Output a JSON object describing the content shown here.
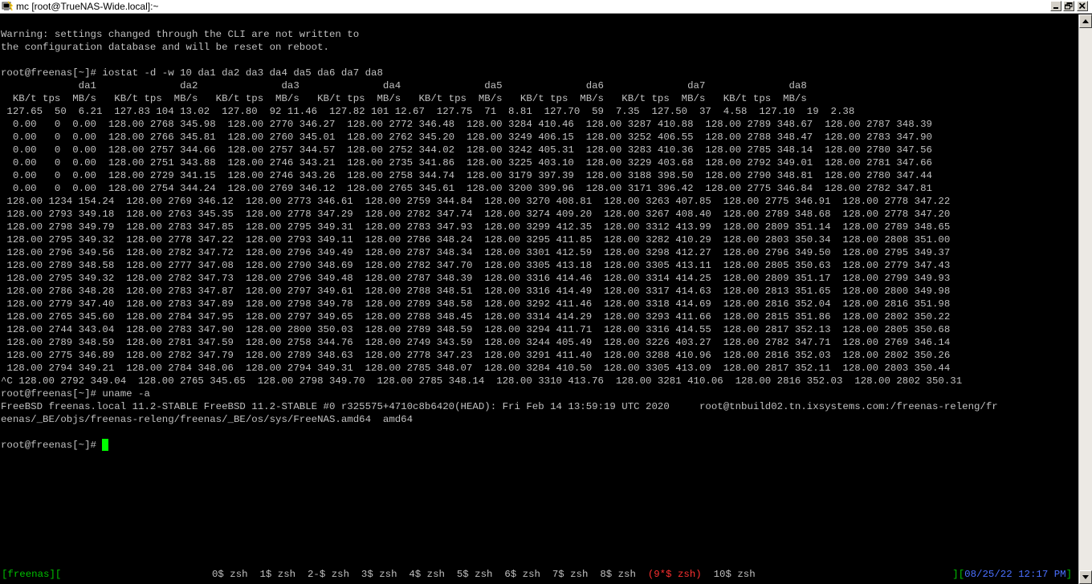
{
  "window": {
    "title": "mc [root@TrueNAS-Wide.local]:~",
    "icon": "putty-terminal-icon"
  },
  "terminal": {
    "lines": [
      "Warning: settings changed through the CLI are not written to",
      "the configuration database and will be reset on reboot.",
      "",
      "root@freenas[~]# iostat -d -w 10 da1 da2 da3 da4 da5 da6 da7 da8",
      "             da1              da2              da3              da4              da5              da6              da7              da8",
      "  KB/t tps  MB/s   KB/t tps  MB/s   KB/t tps  MB/s   KB/t tps  MB/s   KB/t tps  MB/s   KB/t tps  MB/s   KB/t tps  MB/s   KB/t tps  MB/s",
      " 127.65  50  6.21  127.83 104 13.02  127.80  92 11.46  127.82 101 12.67  127.75  71  8.81  127.70  59  7.35  127.50  37  4.58  127.10  19  2.38",
      "  0.00   0  0.00  128.00 2768 345.98  128.00 2770 346.27  128.00 2772 346.48  128.00 3284 410.46  128.00 3287 410.88  128.00 2789 348.67  128.00 2787 348.39",
      "  0.00   0  0.00  128.00 2766 345.81  128.00 2760 345.01  128.00 2762 345.20  128.00 3249 406.15  128.00 3252 406.55  128.00 2788 348.47  128.00 2783 347.90",
      "  0.00   0  0.00  128.00 2757 344.66  128.00 2757 344.57  128.00 2752 344.02  128.00 3242 405.31  128.00 3283 410.36  128.00 2785 348.14  128.00 2780 347.56",
      "  0.00   0  0.00  128.00 2751 343.88  128.00 2746 343.21  128.00 2735 341.86  128.00 3225 403.10  128.00 3229 403.68  128.00 2792 349.01  128.00 2781 347.66",
      "  0.00   0  0.00  128.00 2729 341.15  128.00 2746 343.26  128.00 2758 344.74  128.00 3179 397.39  128.00 3188 398.50  128.00 2790 348.81  128.00 2780 347.44",
      "  0.00   0  0.00  128.00 2754 344.24  128.00 2769 346.12  128.00 2765 345.61  128.00 3200 399.96  128.00 3171 396.42  128.00 2775 346.84  128.00 2782 347.81",
      " 128.00 1234 154.24  128.00 2769 346.12  128.00 2773 346.61  128.00 2759 344.84  128.00 3270 408.81  128.00 3263 407.85  128.00 2775 346.91  128.00 2778 347.22",
      " 128.00 2793 349.18  128.00 2763 345.35  128.00 2778 347.29  128.00 2782 347.74  128.00 3274 409.20  128.00 3267 408.40  128.00 2789 348.68  128.00 2778 347.20",
      " 128.00 2798 349.79  128.00 2783 347.85  128.00 2795 349.31  128.00 2783 347.93  128.00 3299 412.35  128.00 3312 413.99  128.00 2809 351.14  128.00 2789 348.65",
      " 128.00 2795 349.32  128.00 2778 347.22  128.00 2793 349.11  128.00 2786 348.24  128.00 3295 411.85  128.00 3282 410.29  128.00 2803 350.34  128.00 2808 351.00",
      " 128.00 2796 349.56  128.00 2782 347.72  128.00 2796 349.49  128.00 2787 348.34  128.00 3301 412.59  128.00 3298 412.27  128.00 2796 349.50  128.00 2795 349.37",
      " 128.00 2789 348.58  128.00 2777 347.08  128.00 2790 348.69  128.00 2782 347.70  128.00 3305 413.18  128.00 3305 413.11  128.00 2805 350.63  128.00 2779 347.43",
      " 128.00 2795 349.32  128.00 2782 347.73  128.00 2796 349.48  128.00 2787 348.39  128.00 3316 414.46  128.00 3314 414.25  128.00 2809 351.17  128.00 2799 349.93",
      " 128.00 2786 348.28  128.00 2783 347.87  128.00 2797 349.61  128.00 2788 348.51  128.00 3316 414.49  128.00 3317 414.63  128.00 2813 351.65  128.00 2800 349.98",
      " 128.00 2779 347.40  128.00 2783 347.89  128.00 2798 349.78  128.00 2789 348.58  128.00 3292 411.46  128.00 3318 414.69  128.00 2816 352.04  128.00 2816 351.98",
      " 128.00 2765 345.60  128.00 2784 347.95  128.00 2797 349.65  128.00 2788 348.45  128.00 3314 414.29  128.00 3293 411.66  128.00 2815 351.86  128.00 2802 350.22",
      " 128.00 2744 343.04  128.00 2783 347.90  128.00 2800 350.03  128.00 2789 348.59  128.00 3294 411.71  128.00 3316 414.55  128.00 2817 352.13  128.00 2805 350.68",
      " 128.00 2789 348.59  128.00 2781 347.59  128.00 2758 344.76  128.00 2749 343.59  128.00 3244 405.49  128.00 3226 403.27  128.00 2782 347.71  128.00 2769 346.14",
      " 128.00 2775 346.89  128.00 2782 347.79  128.00 2789 348.63  128.00 2778 347.23  128.00 3291 411.40  128.00 3288 410.96  128.00 2816 352.03  128.00 2802 350.26",
      " 128.00 2794 349.21  128.00 2784 348.06  128.00 2794 349.31  128.00 2785 348.07  128.00 3284 410.50  128.00 3305 413.09  128.00 2817 352.11  128.00 2803 350.44",
      "^C 128.00 2792 349.04  128.00 2765 345.65  128.00 2798 349.70  128.00 2785 348.14  128.00 3310 413.76  128.00 3281 410.06  128.00 2816 352.03  128.00 2802 350.31",
      "root@freenas[~]# uname -a",
      "FreeBSD freenas.local 11.2-STABLE FreeBSD 11.2-STABLE #0 r325575+4710c8b6420(HEAD): Fri Feb 14 13:59:19 UTC 2020     root@tnbuild02.tn.ixsystems.com:/freenas-releng/fr",
      "eenas/_BE/objs/freenas-releng/freenas/_BE/os/sys/FreeNAS.amd64  amd64"
    ],
    "prompt": "root@freenas[~]# ",
    "cursor_color": "#00ff00"
  },
  "statusbar": {
    "session": "[freenas][",
    "windows_before": "0$ zsh  1$ zsh  2-$ zsh  3$ zsh  4$ zsh  5$ zsh  6$ zsh  7$ zsh  8$ zsh  ",
    "active_window": "(9*$ zsh)",
    "windows_after": "  10$ zsh",
    "clock_open": "][",
    "clock": "08/25/22 12:17 PM",
    "clock_close": "]"
  },
  "colors": {
    "background": "#000000",
    "text": "#c0c0c0",
    "status_green": "#00c000",
    "active_red": "#ff3030",
    "clock_blue": "#4a6fff"
  }
}
